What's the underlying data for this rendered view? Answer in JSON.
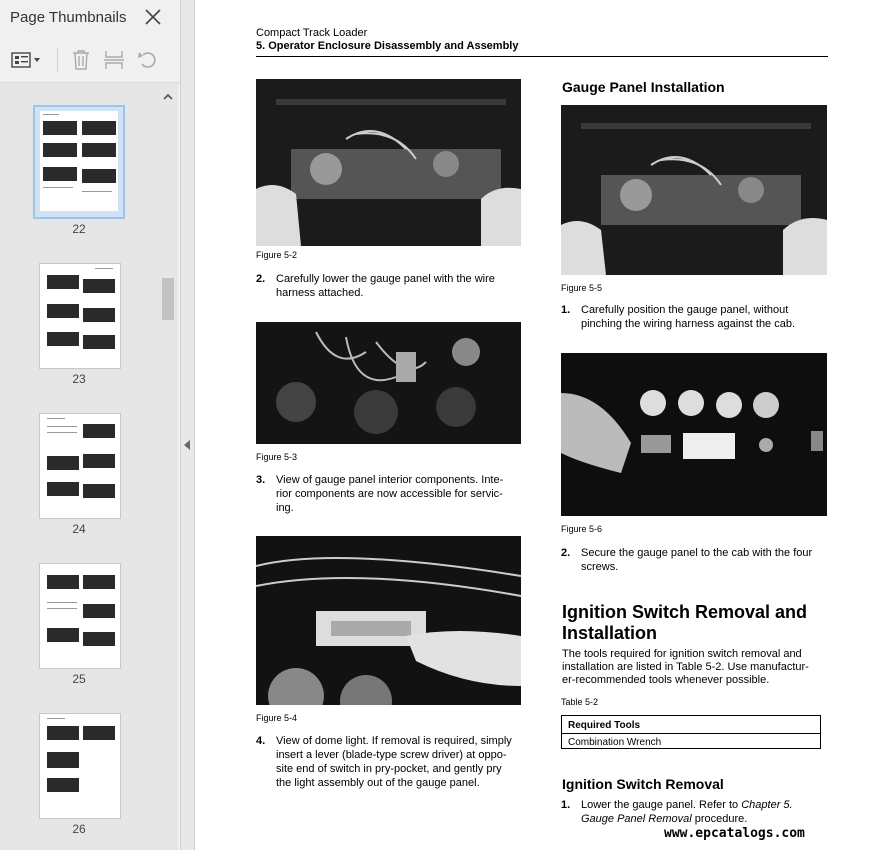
{
  "sidebar": {
    "title": "Page Thumbnails",
    "thumbnails": [
      {
        "page": "22",
        "selected": true
      },
      {
        "page": "23",
        "selected": false
      },
      {
        "page": "24",
        "selected": false
      },
      {
        "page": "25",
        "selected": false
      },
      {
        "page": "26",
        "selected": false
      }
    ]
  },
  "document": {
    "header_line1": "Compact Track Loader",
    "header_line2": "5. Operator Enclosure Disassembly and Assembly",
    "left_column": {
      "fig1_caption": "Figure 5-2",
      "step2_num": "2.",
      "step2_text_l1": "Carefully lower the gauge panel with the wire",
      "step2_text_l2": "harness attached.",
      "fig2_caption": "Figure 5-3",
      "step3_num": "3.",
      "step3_text_l1": "View of gauge panel interior components. Inte-",
      "step3_text_l2": "rior components are now accessible for servic-",
      "step3_text_l3": "ing.",
      "fig3_caption": "Figure 5-4",
      "step4_num": "4.",
      "step4_text_l1": "View of dome light. If removal is required, simply",
      "step4_text_l2": "insert a lever (blade-type screw driver) at oppo-",
      "step4_text_l3": "site end of switch in pry-pocket, and gently pry",
      "step4_text_l4": "the light assembly out of the gauge panel."
    },
    "right_column": {
      "heading_gauge": "Gauge Panel Installation",
      "fig4_caption": "Figure 5-5",
      "step1_num": "1.",
      "step1_text_l1": "Carefully position the gauge panel, without",
      "step1_text_l2": "pinching the wiring harness against the cab.",
      "fig5_caption": "Figure 5-6",
      "step2b_num": "2.",
      "step2b_text_l1": "Secure the gauge panel to the cab with the four",
      "step2b_text_l2": "screws.",
      "heading_ignition_l1": "Ignition Switch Removal and",
      "heading_ignition_l2": "Installation",
      "para_l1": "The tools required for ignition switch removal and",
      "para_l2": "installation are listed in Table 5-2. Use manufactur-",
      "para_l3": "er-recommended tools whenever possible.",
      "table_caption": "Table 5-2",
      "table_header": "Required Tools",
      "table_row1": "Combination Wrench",
      "heading_removal": "Ignition Switch Removal",
      "step1b_num": "1.",
      "step1b_text_l1_a": "Lower the gauge panel. Refer to ",
      "step1b_text_l1_b": "Chapter 5.",
      "step1b_text_l2_a": "Gauge Panel Removal",
      "step1b_text_l2_b": " procedure."
    },
    "watermark": "www.epcatalogs.com"
  },
  "icons": {
    "close": "close-icon",
    "options": "thumbnail-options-icon",
    "delete": "trash-icon",
    "extract": "crop-pages-icon",
    "rotate": "rotate-icon",
    "scroll_up": "chevron-up-icon",
    "collapse": "chevron-left-icon"
  }
}
